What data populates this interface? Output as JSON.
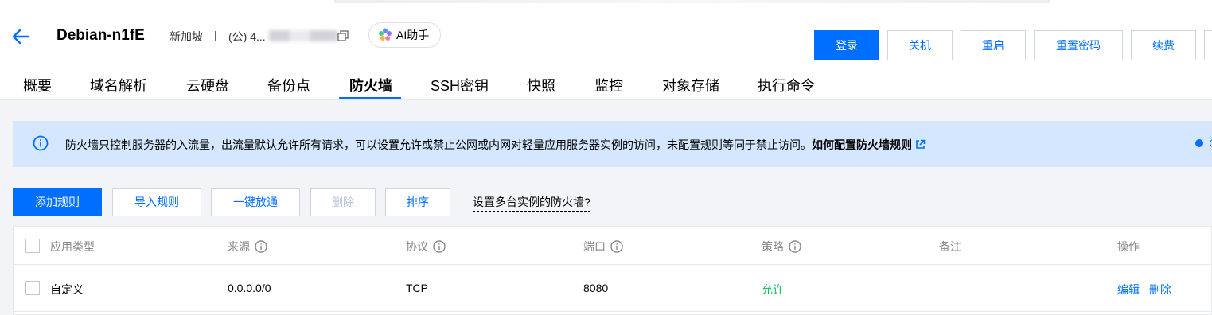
{
  "header": {
    "title": "Debian-n1fE",
    "region": "新加坡",
    "separator": "|",
    "ip_prefix": "(公) 4...",
    "ai_button": "AI助手"
  },
  "actions": {
    "login": "登录",
    "shutdown": "关机",
    "restart": "重启",
    "reset_password": "重置密码",
    "renew": "续费"
  },
  "tabs": [
    "概要",
    "域名解析",
    "云硬盘",
    "备份点",
    "防火墙",
    "SSH密钥",
    "快照",
    "监控",
    "对象存储",
    "执行命令"
  ],
  "notice": {
    "message": "防火墙只控制服务器的入流量，出流量默认允许所有请求，可以设置允许或禁止公网或内网对轻量应用服务器实例的访问，未配置规则等同于禁止访问。",
    "link": "如何配置防火墙规则"
  },
  "toolbar": {
    "add_rule": "添加规则",
    "import_rules": "导入规则",
    "one_click_open": "一键放通",
    "delete": "删除",
    "sort": "排序",
    "multi_instance": "设置多台实例的防火墙?"
  },
  "table": {
    "columns": [
      "应用类型",
      "来源",
      "协议",
      "端口",
      "策略",
      "备注",
      "操作"
    ],
    "rows": [
      {
        "app_type": "自定义",
        "source": "0.0.0.0/0",
        "protocol": "TCP",
        "port": "8080",
        "policy": "允许",
        "note": "",
        "edit": "编辑",
        "delete": "删除"
      }
    ]
  },
  "colors": {
    "primary": "#006eff",
    "notice_bg": "#d5e7ff",
    "allow": "#0abf5b"
  }
}
